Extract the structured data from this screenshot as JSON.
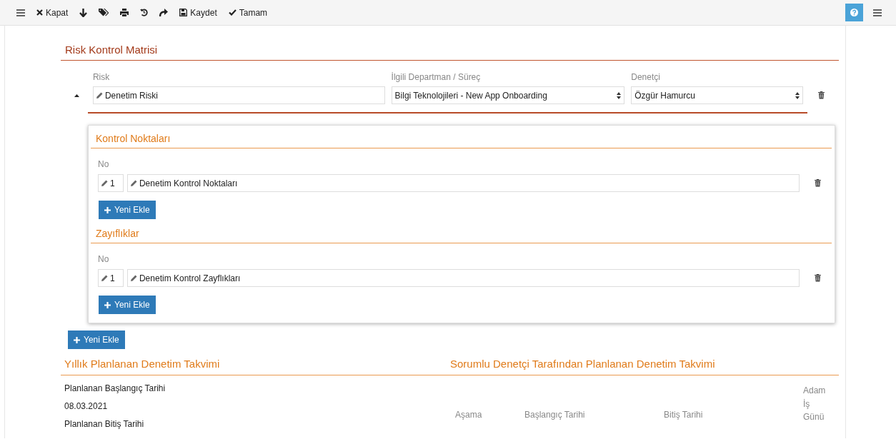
{
  "toolbar": {
    "items": [
      {
        "kind": "menu"
      },
      {
        "kind": "close",
        "label": "Kapat"
      },
      {
        "kind": "down"
      },
      {
        "kind": "tags"
      },
      {
        "kind": "print"
      },
      {
        "kind": "history"
      },
      {
        "kind": "redo"
      },
      {
        "kind": "save",
        "label": "Kaydet"
      },
      {
        "kind": "check",
        "label": "Tamam"
      }
    ],
    "right": [
      {
        "kind": "help"
      },
      {
        "kind": "menu"
      }
    ]
  },
  "matrix": {
    "title": "Risk Kontrol Matrisi",
    "risks": [
      {
        "expanded": true,
        "risk_label": "Risk",
        "risk": "Denetim Riski",
        "department_label": "İlgili Departman / Süreç",
        "department": "Bilgi Teknolojileri - New App Onboarding",
        "auditor_label": "Denetçi",
        "auditor": "Özgür Hamurcu",
        "sections": [
          {
            "title": "Kontrol Noktaları",
            "no_label": "No",
            "rows": [
              {
                "no": "1",
                "text": "Denetim Kontrol Noktaları"
              }
            ],
            "add_button": "Yeni Ekle"
          },
          {
            "title": "Zayıflıklar",
            "no_label": "No",
            "rows": [
              {
                "no": "1",
                "text": "Denetim Kontrol Zayflıkları"
              }
            ],
            "add_button": "Yeni Ekle"
          }
        ]
      }
    ],
    "add_button": "Yeni Ekle"
  },
  "yearly_plan": {
    "title": "Yıllık Planlanan Denetim Takvimi",
    "fields": [
      {
        "label": "Planlanan Başlangıç Tarihi",
        "value": "08.03.2021"
      },
      {
        "label": "Planlanan Bitiş Tarihi"
      }
    ]
  },
  "auditor_plan": {
    "title": "Sorumlu Denetçi Tarafından Planlanan Denetim Takvimi",
    "columns": [
      "Aşama",
      "Başlangıç Tarihi",
      "Bitiş Tarihi",
      "Adam İş Günü"
    ]
  }
}
